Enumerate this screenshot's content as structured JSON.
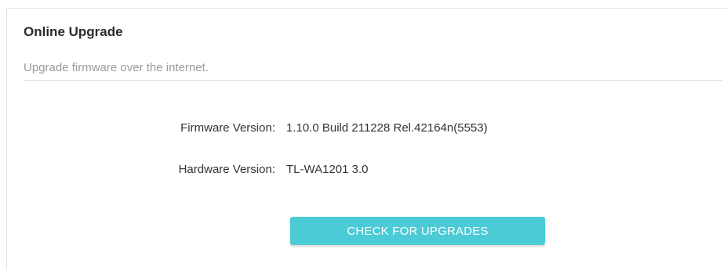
{
  "section": {
    "title": "Online Upgrade",
    "description": "Upgrade firmware over the internet."
  },
  "info": {
    "firmware_label": "Firmware Version:",
    "firmware_value": "1.10.0 Build 211228 Rel.42164n(5553)",
    "hardware_label": "Hardware Version:",
    "hardware_value": "TL-WA1201 3.0"
  },
  "actions": {
    "check_label": "CHECK FOR UPGRADES"
  },
  "colors": {
    "accent": "#4acbd6",
    "title_text": "#2b2b2b",
    "muted_text": "#9a9a9a",
    "divider": "#dddddd"
  }
}
